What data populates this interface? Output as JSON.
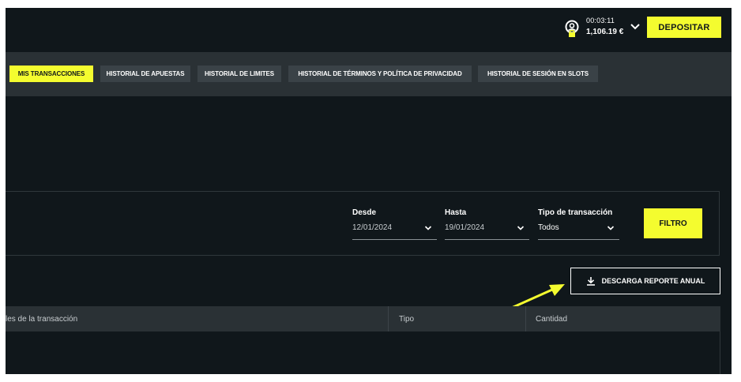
{
  "header": {
    "timer": "00:03:11",
    "balance": "1,106.19 €",
    "deposit_label": "DEPOSITAR"
  },
  "nav": {
    "tabs": [
      {
        "label": "MIS TRANSACCIONES",
        "active": true
      },
      {
        "label": "HISTORIAL DE APUESTAS",
        "active": false
      },
      {
        "label": "HISTORIAL DE LIMITES",
        "active": false
      },
      {
        "label": "HISTORIAL DE TÉRMINOS Y POLÍTICA DE PRIVACIDAD",
        "active": false
      },
      {
        "label": "HISTORIAL DE SESIÓN EN SLOTS",
        "active": false
      }
    ]
  },
  "filters": {
    "desde": {
      "label": "Desde",
      "value": "12/01/2024"
    },
    "hasta": {
      "label": "Hasta",
      "value": "19/01/2024"
    },
    "tipo": {
      "label": "Tipo de transacción",
      "value": "Todos"
    },
    "filter_label": "FILTRO"
  },
  "download": {
    "label": "DESCARGA REPORTE ANUAL"
  },
  "table": {
    "columns": [
      "les de la transacción",
      "Tipo",
      "Cantidad"
    ]
  },
  "colors": {
    "background": "#10171b",
    "nav": "#2a3135",
    "accent": "#f4fc2f",
    "annotation": "#f4fc2f"
  },
  "icons": {
    "user": "user-lock-icon",
    "chevron": "chevron-down-icon",
    "download": "download-icon"
  }
}
